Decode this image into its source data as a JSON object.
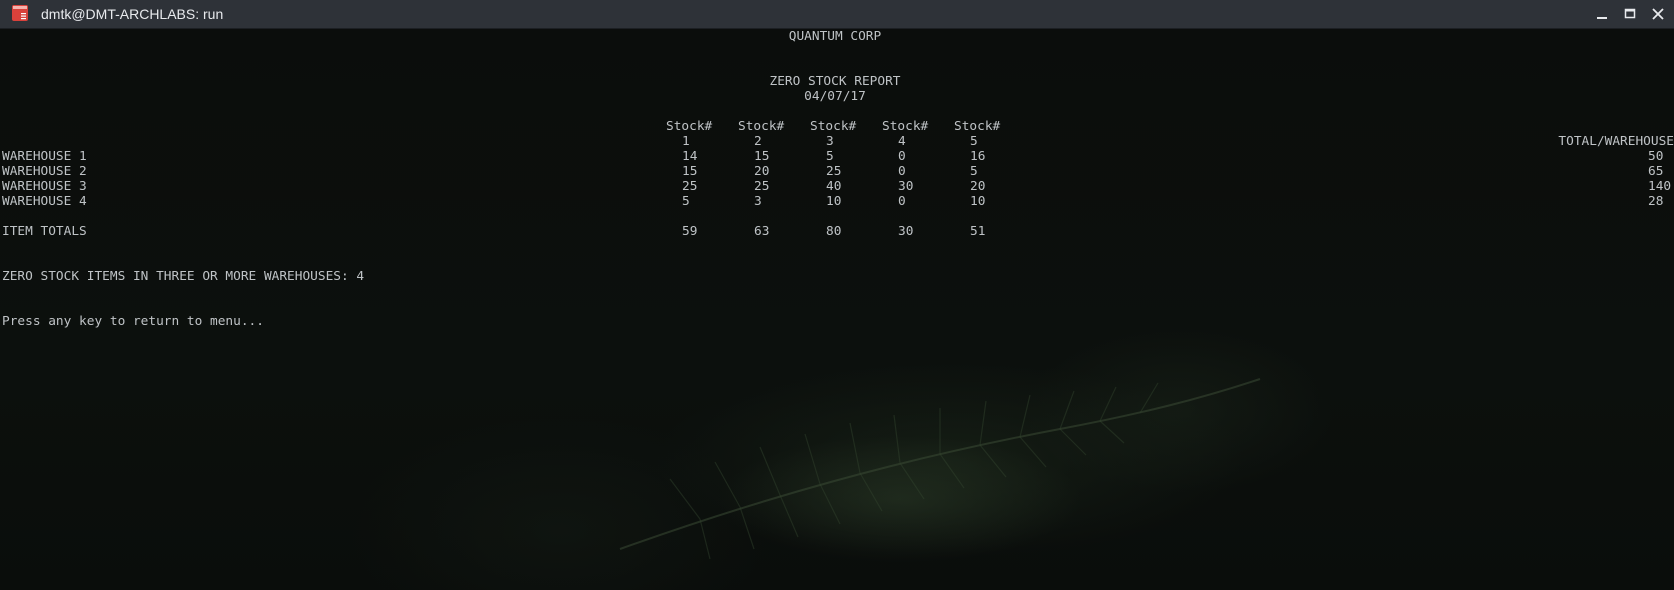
{
  "window": {
    "title": "dmtk@DMT-ARCHLABS: run",
    "icon": "terminal-app-icon",
    "controls": [
      "minimize-icon",
      "maximize-icon",
      "close-icon"
    ]
  },
  "report": {
    "company": "QUANTUM CORP",
    "title": "ZERO STOCK REPORT",
    "date": "04/07/17",
    "stock_header": "Stock#",
    "stock_numbers": [
      "1",
      "2",
      "3",
      "4",
      "5"
    ],
    "total_header": "TOTAL/WAREHOUSE",
    "rows": [
      {
        "label": "WAREHOUSE 1",
        "values": [
          "14",
          "15",
          "5",
          "0",
          "16"
        ],
        "total": "50"
      },
      {
        "label": "WAREHOUSE 2",
        "values": [
          "15",
          "20",
          "25",
          "0",
          "5"
        ],
        "total": "65"
      },
      {
        "label": "WAREHOUSE 3",
        "values": [
          "25",
          "25",
          "40",
          "30",
          "20"
        ],
        "total": "140"
      },
      {
        "label": "WAREHOUSE 4",
        "values": [
          "5",
          "3",
          "10",
          "0",
          "10"
        ],
        "total": "28"
      }
    ],
    "totals_label": "ITEM TOTALS",
    "totals": [
      "59",
      "63",
      "80",
      "30",
      "51"
    ],
    "summary": "ZERO STOCK ITEMS IN THREE OR MORE WAREHOUSES: 4",
    "prompt": "Press any key to return to menu..."
  },
  "colors": {
    "text": "#bfc3c6",
    "titlebar": "#2e3238",
    "background": "#0b0d0c",
    "icon_red": "#d9413b"
  }
}
